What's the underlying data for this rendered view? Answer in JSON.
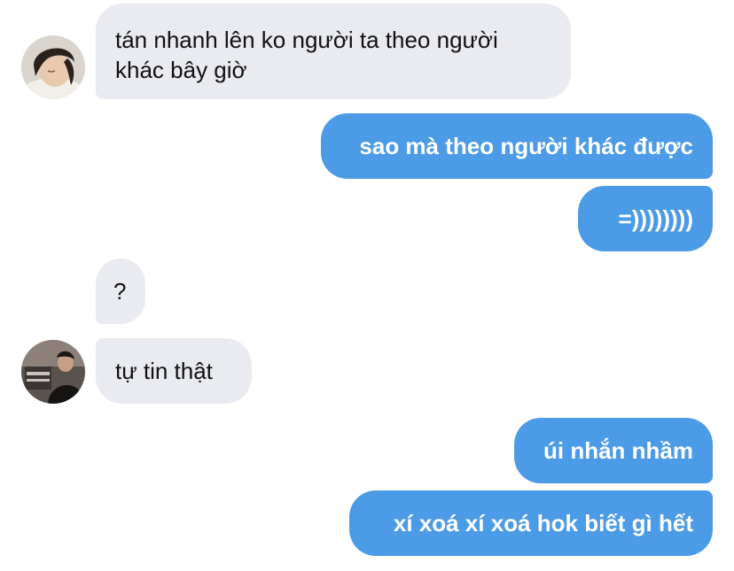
{
  "conversation": {
    "messages": [
      {
        "id": "m1",
        "from": "other",
        "text": "tán nhanh lên ko người ta theo người khác bây giờ",
        "avatar": "avatar-photo-girl"
      },
      {
        "id": "m2",
        "from": "me",
        "text": "sao mà theo người khác được"
      },
      {
        "id": "m3",
        "from": "me",
        "text": "=))))))))"
      },
      {
        "id": "m4",
        "from": "other",
        "text": "?"
      },
      {
        "id": "m5",
        "from": "other",
        "text": "tự tin thật",
        "avatar": "avatar-photo-boy"
      },
      {
        "id": "m6",
        "from": "me",
        "text": "úi nhắn nhầm"
      },
      {
        "id": "m7",
        "from": "me",
        "text": "xí xoá xí xoá hok biết gì hết"
      }
    ]
  },
  "colors": {
    "incoming_bubble": "#e9ebf0",
    "outgoing_bubble": "#4c9be6",
    "incoming_text": "#111111",
    "outgoing_text": "#ffffff"
  }
}
